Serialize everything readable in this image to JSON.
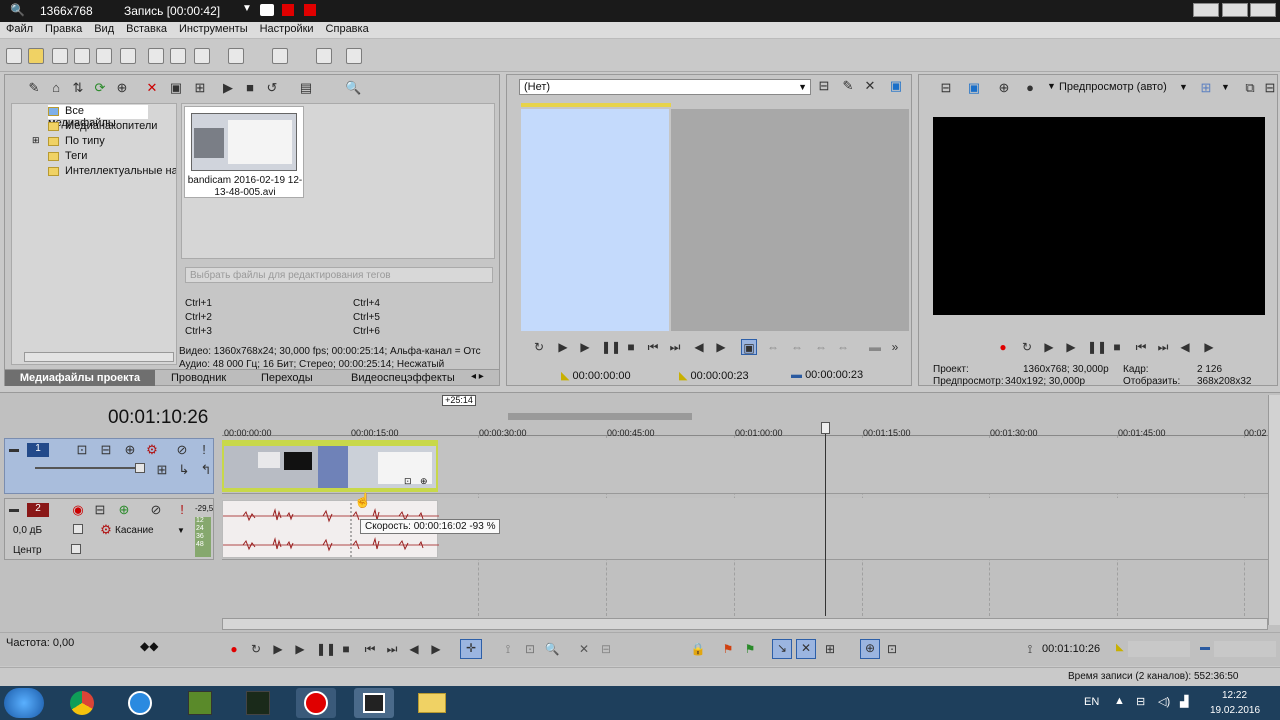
{
  "recorder": {
    "resolution": "1366x768",
    "status": "Запись [00:00:42]"
  },
  "menu": [
    "Файл",
    "Правка",
    "Вид",
    "Вставка",
    "Инструменты",
    "Настройки",
    "Справка"
  ],
  "media": {
    "tree": [
      "Все медиафайлы",
      "Медианакопители",
      "По типу",
      "Теги",
      "Интеллектуальные нак"
    ],
    "file_name": "bandicam 2016-02-19 12-13-48-005.avi",
    "tag_placeholder": "Выбрать файлы для редактирования тегов",
    "shortcuts": [
      "Ctrl+1",
      "Ctrl+4",
      "Ctrl+2",
      "Ctrl+5",
      "Ctrl+3",
      "Ctrl+6"
    ],
    "info_video": "Видео: 1360x768x24; 30,000 fps; 00:00:25:14; Альфа-канал = Отс",
    "info_audio": "Аудио: 48 000 Гц; 16 Бит; Стерео; 00:00:25:14; Несжатый",
    "tabs": [
      "Медиафайлы проекта",
      "Проводник",
      "Переходы",
      "Видеоспецэффекты"
    ]
  },
  "trimmer": {
    "selector": "(Нет)",
    "time_start": "00:00:00:00",
    "time_end": "00:00:00:23",
    "time_length": "00:00:00:23"
  },
  "preview": {
    "mode": "Предпросмотр (авто)",
    "project_label": "Проект:",
    "project_value": "1360x768; 30,000p",
    "preview_label": "Предпросмотр:",
    "preview_value": "340x192; 30,000p",
    "frame_label": "Кадр:",
    "frame_value": "2 126",
    "display_label": "Отобразить:",
    "display_value": "368x208x32"
  },
  "timeline": {
    "current_time": "00:01:10:26",
    "badge": "+25:14",
    "ticks": [
      "00:00:00:00",
      "00:00:15:00",
      "00:00:30:00",
      "00:00:45:00",
      "00:01:00:00",
      "00:01:15:00",
      "00:01:30:00",
      "00:01:45:00",
      "00:02"
    ],
    "video_track_num": "1",
    "audio_track_num": "2",
    "audio_volume": "0,0 дБ",
    "audio_mode": "Касание",
    "audio_pan": "Центр",
    "db_marks": [
      "-29,5",
      "12",
      "24",
      "36",
      "48"
    ],
    "tooltip": "Скорость: 00:00:16:02 -93 %"
  },
  "bottom": {
    "rate": "Частота: 0,00",
    "time": "00:01:10:26",
    "record_time": "Время записи (2 каналов): 552:36:50"
  },
  "tray": {
    "lang": "EN",
    "time": "12:22",
    "date": "19.02.2016"
  },
  "colors": {
    "accent_blue": "#c4dafc",
    "clip_green": "#c8d84a",
    "record_red": "#e00000"
  }
}
